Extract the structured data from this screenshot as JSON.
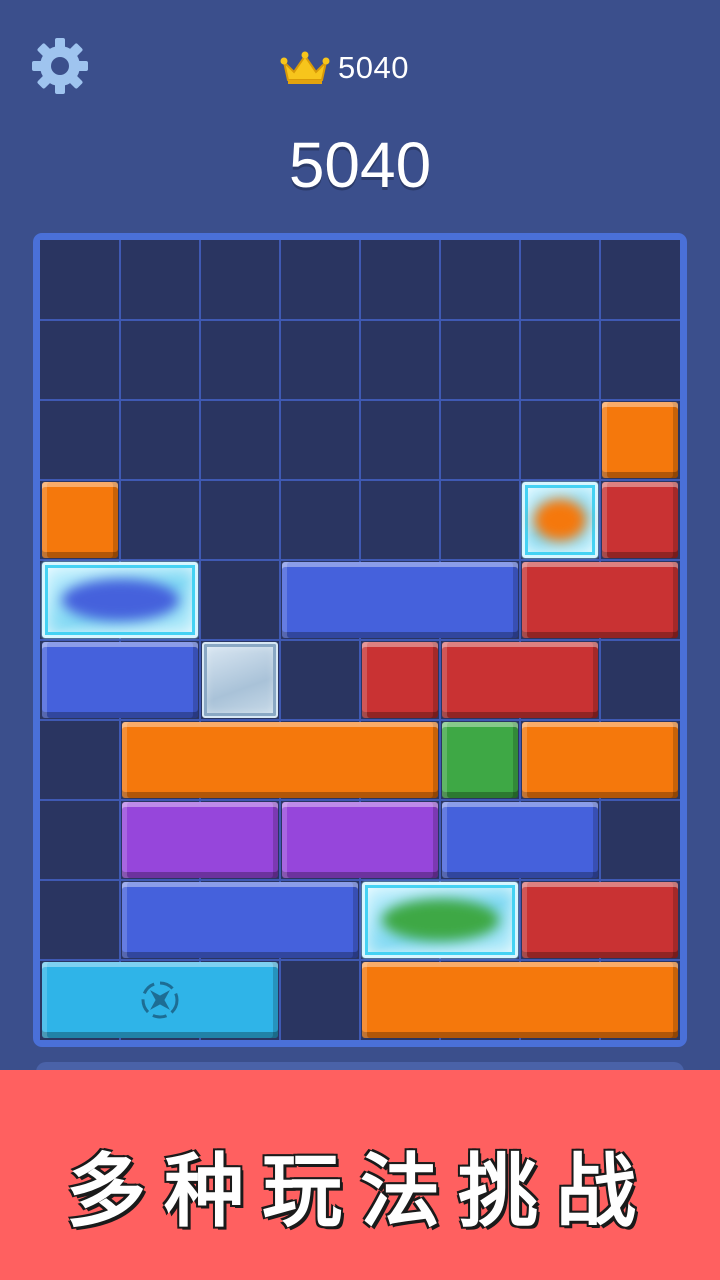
{
  "header": {
    "settings_icon": "gear-icon",
    "best_icon": "crown-icon",
    "best_score": "5040",
    "score": "5040"
  },
  "board": {
    "cols": 8,
    "rows": 10,
    "blocks": [
      {
        "row": 2,
        "col": 7,
        "len": 1,
        "color": "orange",
        "kind": "normal"
      },
      {
        "row": 3,
        "col": 0,
        "len": 1,
        "color": "orange",
        "kind": "normal"
      },
      {
        "row": 3,
        "col": 6,
        "len": 1,
        "color": "orange",
        "kind": "ice"
      },
      {
        "row": 3,
        "col": 7,
        "len": 1,
        "color": "red",
        "kind": "normal"
      },
      {
        "row": 4,
        "col": 0,
        "len": 2,
        "color": "blue",
        "kind": "ice"
      },
      {
        "row": 4,
        "col": 3,
        "len": 3,
        "color": "blue",
        "kind": "normal"
      },
      {
        "row": 4,
        "col": 6,
        "len": 2,
        "color": "red",
        "kind": "normal"
      },
      {
        "row": 5,
        "col": 0,
        "len": 2,
        "color": "blue",
        "kind": "normal"
      },
      {
        "row": 5,
        "col": 2,
        "len": 1,
        "color": "grey",
        "kind": "stone"
      },
      {
        "row": 5,
        "col": 4,
        "len": 1,
        "color": "red",
        "kind": "normal"
      },
      {
        "row": 5,
        "col": 5,
        "len": 2,
        "color": "red",
        "kind": "normal"
      },
      {
        "row": 6,
        "col": 1,
        "len": 4,
        "color": "orange",
        "kind": "normal"
      },
      {
        "row": 6,
        "col": 5,
        "len": 1,
        "color": "green",
        "kind": "normal"
      },
      {
        "row": 6,
        "col": 6,
        "len": 2,
        "color": "orange",
        "kind": "normal"
      },
      {
        "row": 7,
        "col": 1,
        "len": 2,
        "color": "purple",
        "kind": "normal"
      },
      {
        "row": 7,
        "col": 3,
        "len": 2,
        "color": "purple",
        "kind": "normal"
      },
      {
        "row": 7,
        "col": 5,
        "len": 2,
        "color": "blue",
        "kind": "normal"
      },
      {
        "row": 8,
        "col": 1,
        "len": 3,
        "color": "blue",
        "kind": "normal"
      },
      {
        "row": 8,
        "col": 4,
        "len": 2,
        "color": "green",
        "kind": "ice"
      },
      {
        "row": 8,
        "col": 6,
        "len": 2,
        "color": "red",
        "kind": "normal"
      },
      {
        "row": 9,
        "col": 0,
        "len": 3,
        "color": "cyan",
        "kind": "cross"
      },
      {
        "row": 9,
        "col": 4,
        "len": 4,
        "color": "orange",
        "kind": "normal"
      }
    ]
  },
  "colors": {
    "orange": "#f5780c",
    "red": "#c93233",
    "blue": "#4561dc",
    "green": "#3ea845",
    "purple": "#9646db",
    "cyan": "#2fb4e8",
    "grey": "#b7cde0",
    "ice": "#9fe3f6",
    "banner": "#ff6060"
  },
  "banner": {
    "text": "多种玩法挑战"
  }
}
